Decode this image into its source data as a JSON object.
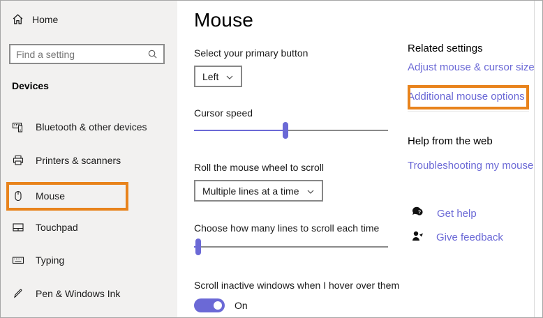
{
  "sidebar": {
    "home_label": "Home",
    "search_placeholder": "Find a setting",
    "section_heading": "Devices",
    "items": [
      {
        "label": "Bluetooth & other devices",
        "icon": "bluetooth-devices-icon",
        "selected": false
      },
      {
        "label": "Printers & scanners",
        "icon": "printer-icon",
        "selected": false
      },
      {
        "label": "Mouse",
        "icon": "mouse-icon",
        "selected": true,
        "annotated": true
      },
      {
        "label": "Touchpad",
        "icon": "touchpad-icon",
        "selected": false
      },
      {
        "label": "Typing",
        "icon": "keyboard-icon",
        "selected": false
      },
      {
        "label": "Pen & Windows Ink",
        "icon": "pen-icon",
        "selected": false
      }
    ]
  },
  "main": {
    "title": "Mouse",
    "primary_button": {
      "label": "Select your primary button",
      "value": "Left"
    },
    "cursor_speed": {
      "label": "Cursor speed",
      "value_percent": 47
    },
    "wheel_scroll": {
      "label": "Roll the mouse wheel to scroll",
      "value": "Multiple lines at a time"
    },
    "lines_to_scroll": {
      "label": "Choose how many lines to scroll each time",
      "value_percent": 2
    },
    "scroll_inactive": {
      "label": "Scroll inactive windows when I hover over them",
      "state": "On"
    }
  },
  "related": {
    "heading": "Related settings",
    "link_cursor_size": "Adjust mouse & cursor size",
    "link_additional_options": "Additional mouse options"
  },
  "help": {
    "heading": "Help from the web",
    "link_troubleshooting": "Troubleshooting my mouse",
    "get_help_label": "Get help",
    "give_feedback_label": "Give feedback"
  },
  "colors": {
    "accent": "#6b69d6",
    "link": "#6b69d6",
    "annotation_orange": "#e8831c",
    "sidebar_bg": "#f2f1f0"
  }
}
